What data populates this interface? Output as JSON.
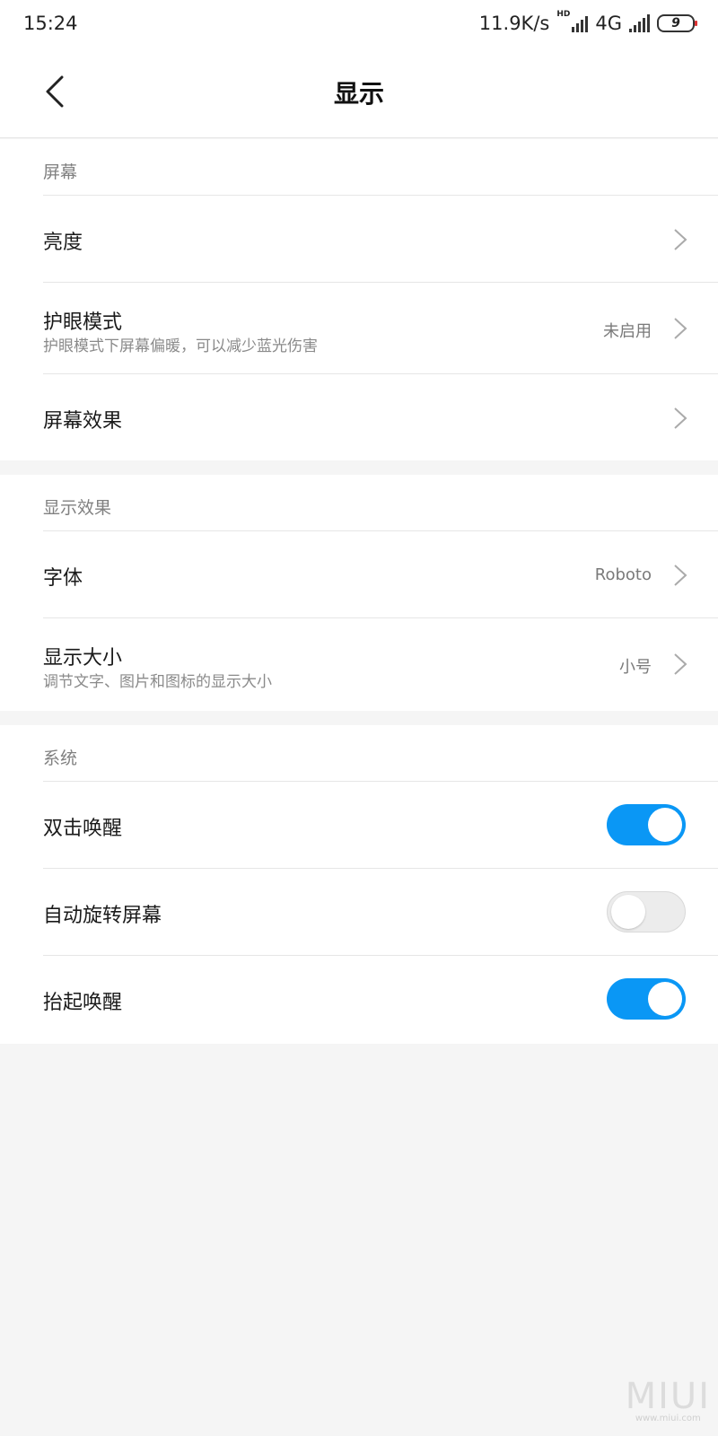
{
  "status_bar": {
    "time": "15:24",
    "net_speed": "11.9K/s",
    "hd": "HD",
    "network": "4G",
    "battery": "9"
  },
  "header": {
    "title": "显示",
    "back_icon": "chevron-left-icon"
  },
  "sections": {
    "screen": {
      "header": "屏幕",
      "brightness": {
        "title": "亮度"
      },
      "eye_care": {
        "title": "护眼模式",
        "subtitle": "护眼模式下屏幕偏暖，可以减少蓝光伤害",
        "value": "未启用"
      },
      "screen_effect": {
        "title": "屏幕效果"
      }
    },
    "display": {
      "header": "显示效果",
      "font": {
        "title": "字体",
        "value": "Roboto"
      },
      "display_size": {
        "title": "显示大小",
        "subtitle": "调节文字、图片和图标的显示大小",
        "value": "小号"
      }
    },
    "system": {
      "header": "系统",
      "double_tap_wake": {
        "title": "双击唤醒",
        "on": true
      },
      "auto_rotate": {
        "title": "自动旋转屏幕",
        "on": false
      },
      "lift_to_wake": {
        "title": "抬起唤醒",
        "on": true
      }
    }
  },
  "colors": {
    "accent": "#0a97f5",
    "background": "#f5f5f5"
  },
  "watermark": {
    "brand": "MIUI",
    "site": "www.miui.com"
  }
}
